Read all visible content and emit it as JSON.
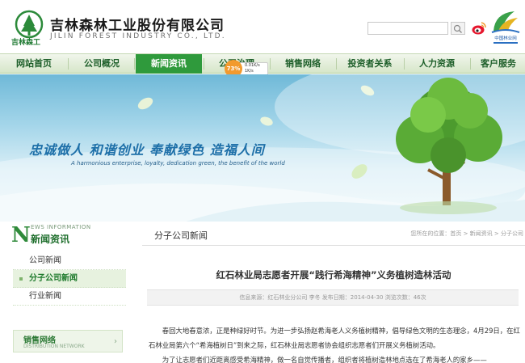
{
  "header": {
    "company_cn": "吉林森林工业股份有限公司",
    "company_en": "JILIN FOREST INDUSTRY CO., LTD.",
    "logo_text": "吉林森工",
    "search_placeholder": "",
    "forest_logo_text": "中国林业网"
  },
  "nav": {
    "items": [
      {
        "label": "网站首页"
      },
      {
        "label": "公司概况"
      },
      {
        "label": "新闻资讯"
      },
      {
        "label": "公司治理"
      },
      {
        "label": "销售网络"
      },
      {
        "label": "投资者关系"
      },
      {
        "label": "人力资源"
      },
      {
        "label": "客户服务"
      }
    ],
    "active_index": 2
  },
  "speed_widget": {
    "percent": "73%",
    "up": "0.01K/s",
    "down": "1K/s"
  },
  "banner": {
    "slogan": "忠诚做人  和谐创业  奉献绿色  造福人间",
    "slogan_en": "A harmonious enterprise, loyalty, dedication green, the benefit of the world"
  },
  "sidebar": {
    "title_en": "EWS INFORMATION",
    "big_letter": "N",
    "title": "新闻资讯",
    "items": [
      {
        "label": "公司新闻",
        "active": false
      },
      {
        "label": "分子公司新闻",
        "active": true
      },
      {
        "label": "行业新闻",
        "active": false
      }
    ],
    "block_title": "销售网络",
    "block_en": "DISTRIBUTION NETWORK"
  },
  "main": {
    "section_title": "分子公司新闻",
    "breadcrumb": "您所在的位置：首页 > 新闻资讯 > 分子公司",
    "article_title": "红石林业局志愿者开展“践行希海精神”义务植树造林活动",
    "meta": "信息来源：红石林业分公司 李冬      发布日期：2014-04-30      浏览次数：46次",
    "paragraphs": [
      "春回大地春意浓，正是种绿好时节。为进一步弘扬赵希海老人义务植树精神，倡导绿色文明的生态理念，4月29日，在红石林业局第六个“希海植树日”到来之际，红石林业局志愿者协会组织志愿者们开展义务植树活动。",
      "为了让志愿者们近距离感受希海精神，做一名自觉传播者，组织者将植树造林地点选在了希海老人的家乡——"
    ]
  },
  "colors": {
    "brand_green": "#2f9a3c",
    "nav_text": "#1e5f2a",
    "slogan_blue": "#1d6fa8"
  }
}
